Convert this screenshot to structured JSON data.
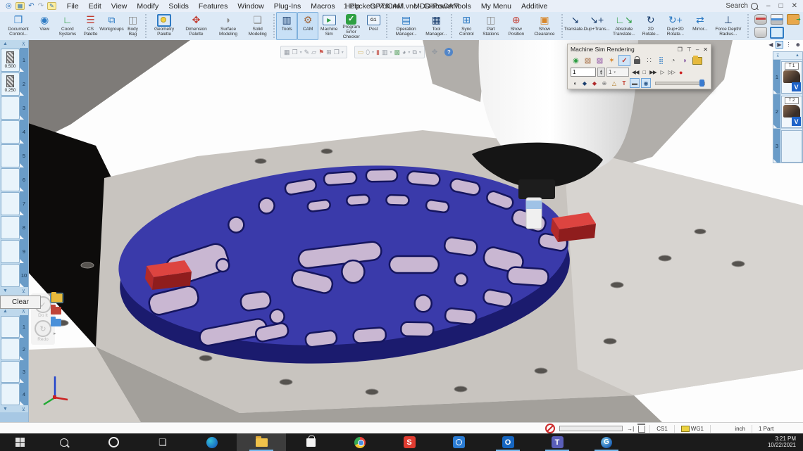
{
  "titlebar": {
    "title": "1 Pockets Volumill.vnc - GibbsCAM",
    "search_label": "Search",
    "menus": [
      "File",
      "Edit",
      "View",
      "Modify",
      "Solids",
      "Features",
      "Window",
      "Plug-Ins",
      "Macros",
      "Help",
      "OPTICAM",
      "MDD-PowerTools",
      "My Menu",
      "Additive"
    ]
  },
  "ribbon": {
    "buttons": [
      {
        "label": "Document Control..."
      },
      {
        "label": "View"
      },
      {
        "label": "Coord Systems"
      },
      {
        "label": "CS Palette"
      },
      {
        "label": "Workgroups"
      },
      {
        "label": "Body Bag"
      },
      {
        "label": "Geometry Palette"
      },
      {
        "label": "Dimension Palette"
      },
      {
        "label": "Surface Modeling"
      },
      {
        "label": "Solid Modeling"
      },
      {
        "label": "Tools"
      },
      {
        "label": "CAM"
      },
      {
        "label": "Machine Sim"
      },
      {
        "label": "Program Error Checker"
      },
      {
        "label": "Post"
      },
      {
        "label": "Operation Manager..."
      },
      {
        "label": "Tool Manager..."
      },
      {
        "label": "Sync Control"
      },
      {
        "label": "Part Stations"
      },
      {
        "label": "Show Position"
      },
      {
        "label": "Show Clearance"
      },
      {
        "label": "Translate..."
      },
      {
        "label": "Dup+Trans..."
      },
      {
        "label": "Absolute Translate..."
      },
      {
        "label": "2D Rotate..."
      },
      {
        "label": "Dup+2D Rotate..."
      },
      {
        "label": "Mirror..."
      },
      {
        "label": "Force Depth/ Radius..."
      }
    ]
  },
  "tool_sidebar": {
    "clear_label": "Clear",
    "slots": [
      {
        "num": "1",
        "value": "0.500"
      },
      {
        "num": "2",
        "value": "0.250"
      },
      {
        "num": "3",
        "value": ""
      },
      {
        "num": "4",
        "value": ""
      },
      {
        "num": "5",
        "value": ""
      },
      {
        "num": "6",
        "value": ""
      },
      {
        "num": "7",
        "value": ""
      },
      {
        "num": "8",
        "value": ""
      },
      {
        "num": "9",
        "value": ""
      },
      {
        "num": "10",
        "value": ""
      }
    ],
    "groups": [
      {
        "num": "1"
      },
      {
        "num": "2"
      },
      {
        "num": "3"
      },
      {
        "num": "4"
      }
    ]
  },
  "viewport_overlay": {
    "do_it_label": "Do It",
    "redo_label": "Redo"
  },
  "sim_palette": {
    "title": "Machine Sim Rendering",
    "frame_field": "1",
    "speed_field": "1"
  },
  "ops_panel": {
    "items": [
      {
        "num": "1",
        "tool": "T 1"
      },
      {
        "num": "2",
        "tool": "T 2"
      },
      {
        "num": "3",
        "tool": ""
      }
    ]
  },
  "statusbar": {
    "cs_label": "CS1",
    "wg_label": "WG1",
    "unit_label": "inch",
    "parts_label": "1 Part"
  },
  "taskbar": {
    "time": "3:21 PM",
    "date": "10/22/2021"
  },
  "icons": {
    "app": "◎",
    "save": "▦",
    "undo": "↶",
    "redo": "↷",
    "customize": "✎",
    "minimize": "–",
    "maximize": "□",
    "close": "✕",
    "doc_control": "❐",
    "view": "◉",
    "coord": "∟",
    "cs_palette": "☰",
    "workgroups": "⧉",
    "body_bag": "◫",
    "dimension": "✥",
    "surface": "◗",
    "solid": "❏",
    "tools": "▥",
    "cam": "⚙",
    "machine_sim": "▶",
    "g1": "G1",
    "op_mgr": "▤",
    "tool_mgr": "▦",
    "sync": "⊞",
    "part_stations": "◫",
    "show_position": "⊕",
    "show_clearance": "▣",
    "translate": "↘",
    "dup_trans": "↘+",
    "abs_translate": "∟↘",
    "rotate2d": "↻",
    "dup_rotate2d": "↻+",
    "mirror": "⇄",
    "force_depth": "⊥",
    "sp_render": "◉",
    "sp_material": "▧",
    "sp_report": "▨",
    "sp_collision": "✶",
    "sp_check": "✓",
    "sp_axes": "∷",
    "sp_traffic": "⣿",
    "sp_inspect": "◔",
    "sp_tool": "◗",
    "t_start": "◀◀",
    "t_stop": "□",
    "t_step": "▶▶",
    "t_play": "▷",
    "t_ff": "▷▷",
    "t_rec": "●",
    "r_shade1": "◖",
    "r_shade2": "◆",
    "r_shade3": "◆",
    "r_target": "⊕",
    "r_warn": "△",
    "r_text": "T",
    "r_key": "▬",
    "r_eye": "◉",
    "rp_prev": "◀",
    "rp_next": "▶",
    "rp_list": "⋮",
    "rp_person": "☻",
    "vt": "▦",
    "vt2": "❐",
    "vt3": "✎",
    "vt4": "▱",
    "vt5": "⚑",
    "vt6": "⊞",
    "vt7": "❐",
    "vt8": "▭",
    "vt9": "⬯",
    "vt10": "▮",
    "vt11": "▥",
    "vt12": "▩",
    "vt13": "◕",
    "vt14": "⧉",
    "expand": "✥",
    "help": "?",
    "caret": "▾",
    "up_arrow": "▲",
    "down_arrow": "▼",
    "pin": "⊤",
    "cascade": "❐",
    "to_end": "→|",
    "outlook_glyph": "O",
    "teams_glyph": "T",
    "snagit_glyph": "S",
    "taskview_glyph": "❏",
    "gibbs_glyph": "G"
  }
}
